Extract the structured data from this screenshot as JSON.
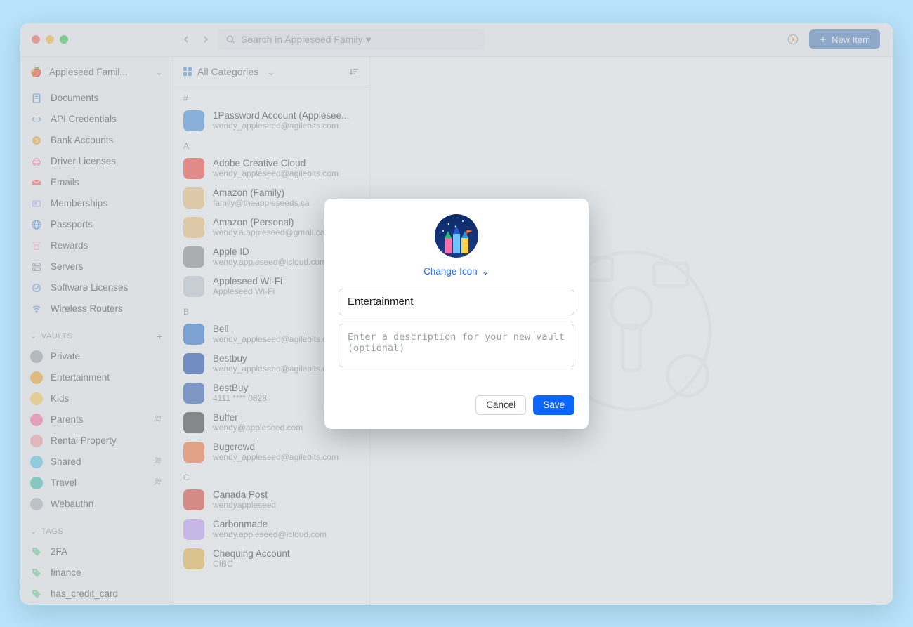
{
  "titlebar": {
    "search_placeholder": "Search in Appleseed Family ♥",
    "new_item_label": "New Item"
  },
  "sidebar": {
    "vault_name": "Appleseed Famil...",
    "categories": [
      {
        "label": "Documents",
        "icon": "document",
        "color": "#4a90e2"
      },
      {
        "label": "API Credentials",
        "icon": "code",
        "color": "#4a90e2"
      },
      {
        "label": "Bank Accounts",
        "icon": "bank",
        "color": "#f5a623"
      },
      {
        "label": "Driver Licenses",
        "icon": "car",
        "color": "#ff6b9d"
      },
      {
        "label": "Emails",
        "icon": "mail",
        "color": "#ff5a52"
      },
      {
        "label": "Memberships",
        "icon": "member",
        "color": "#c49bff"
      },
      {
        "label": "Passports",
        "icon": "passport",
        "color": "#4a90e2"
      },
      {
        "label": "Rewards",
        "icon": "rewards",
        "color": "#ffb3c6"
      },
      {
        "label": "Servers",
        "icon": "server",
        "color": "#8f96a3"
      },
      {
        "label": "Software Licenses",
        "icon": "license",
        "color": "#4a90e2"
      },
      {
        "label": "Wireless Routers",
        "icon": "wifi",
        "color": "#4a90e2"
      }
    ],
    "vaults_header": "VAULTS",
    "vaults": [
      {
        "label": "Private",
        "shared": false
      },
      {
        "label": "Entertainment",
        "shared": false
      },
      {
        "label": "Kids",
        "shared": false
      },
      {
        "label": "Parents",
        "shared": true
      },
      {
        "label": "Rental Property",
        "shared": false
      },
      {
        "label": "Shared",
        "shared": true
      },
      {
        "label": "Travel",
        "shared": true
      },
      {
        "label": "Webauthn",
        "shared": false
      }
    ],
    "tags_header": "TAGS",
    "tags": [
      {
        "label": "2FA"
      },
      {
        "label": "finance"
      },
      {
        "label": "has_credit_card"
      }
    ]
  },
  "list": {
    "header_label": "All Categories",
    "groups": [
      {
        "letter": "#",
        "items": [
          {
            "title": "1Password Account (Applesee...",
            "sub": "wendy_appleseed@agilebits.com",
            "color": "#3c8de0"
          }
        ]
      },
      {
        "letter": "A",
        "items": [
          {
            "title": "Adobe Creative Cloud",
            "sub": "wendy_appleseed@agilebits.com",
            "color": "#ff3b30"
          },
          {
            "title": "Amazon (Family)",
            "sub": "family@theappleseeds.ca",
            "color": "#f7c377"
          },
          {
            "title": "Amazon (Personal)",
            "sub": "wendy.a.appleseed@gmail.com",
            "color": "#f7c377"
          },
          {
            "title": "Apple ID",
            "sub": "wendy.appleseed@icloud.com",
            "color": "#888"
          },
          {
            "title": "Appleseed Wi-Fi",
            "sub": "Appleseed Wi-Fi",
            "color": "#c7cdd5"
          }
        ]
      },
      {
        "letter": "B",
        "items": [
          {
            "title": "Bell",
            "sub": "wendy_appleseed@agilebits.com",
            "color": "#1f6cd6"
          },
          {
            "title": "Bestbuy",
            "sub": "wendy_appleseed@agilebits.com",
            "color": "#0b3ea8"
          },
          {
            "title": "BestBuy",
            "sub": "4111 **** 0828",
            "color": "#2556b7"
          },
          {
            "title": "Buffer",
            "sub": "wendy@appleseed.com",
            "color": "#333"
          },
          {
            "title": "Bugcrowd",
            "sub": "wendy_appleseed@agilebits.com",
            "color": "#ff6a2b"
          }
        ]
      },
      {
        "letter": "C",
        "items": [
          {
            "title": "Canada Post",
            "sub": "wendyappleseed",
            "color": "#e23a2e"
          },
          {
            "title": "Carbonmade",
            "sub": "wendy.appleseed@icloud.com",
            "color": "#c49bff"
          },
          {
            "title": "Chequing Account",
            "sub": "CIBC",
            "color": "#f0b43c"
          }
        ]
      }
    ]
  },
  "modal": {
    "change_icon_label": "Change Icon",
    "name_value": "Entertainment",
    "desc_placeholder": "Enter a description for your new vault (optional)",
    "cancel_label": "Cancel",
    "save_label": "Save"
  }
}
